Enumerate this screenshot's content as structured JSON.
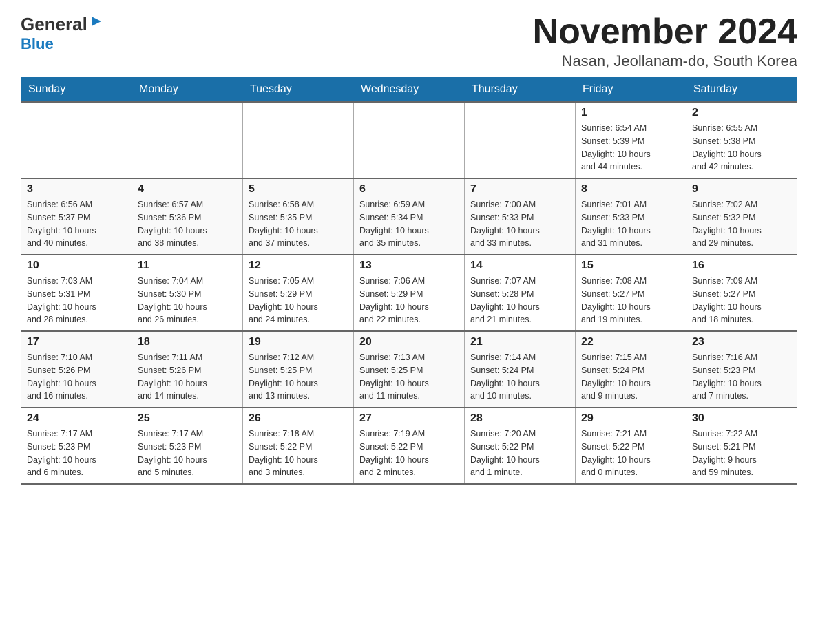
{
  "header": {
    "logo_general": "General",
    "logo_blue": "Blue",
    "month_title": "November 2024",
    "location": "Nasan, Jeollanam-do, South Korea"
  },
  "weekdays": [
    "Sunday",
    "Monday",
    "Tuesday",
    "Wednesday",
    "Thursday",
    "Friday",
    "Saturday"
  ],
  "weeks": [
    [
      {
        "day": "",
        "info": ""
      },
      {
        "day": "",
        "info": ""
      },
      {
        "day": "",
        "info": ""
      },
      {
        "day": "",
        "info": ""
      },
      {
        "day": "",
        "info": ""
      },
      {
        "day": "1",
        "info": "Sunrise: 6:54 AM\nSunset: 5:39 PM\nDaylight: 10 hours\nand 44 minutes."
      },
      {
        "day": "2",
        "info": "Sunrise: 6:55 AM\nSunset: 5:38 PM\nDaylight: 10 hours\nand 42 minutes."
      }
    ],
    [
      {
        "day": "3",
        "info": "Sunrise: 6:56 AM\nSunset: 5:37 PM\nDaylight: 10 hours\nand 40 minutes."
      },
      {
        "day": "4",
        "info": "Sunrise: 6:57 AM\nSunset: 5:36 PM\nDaylight: 10 hours\nand 38 minutes."
      },
      {
        "day": "5",
        "info": "Sunrise: 6:58 AM\nSunset: 5:35 PM\nDaylight: 10 hours\nand 37 minutes."
      },
      {
        "day": "6",
        "info": "Sunrise: 6:59 AM\nSunset: 5:34 PM\nDaylight: 10 hours\nand 35 minutes."
      },
      {
        "day": "7",
        "info": "Sunrise: 7:00 AM\nSunset: 5:33 PM\nDaylight: 10 hours\nand 33 minutes."
      },
      {
        "day": "8",
        "info": "Sunrise: 7:01 AM\nSunset: 5:33 PM\nDaylight: 10 hours\nand 31 minutes."
      },
      {
        "day": "9",
        "info": "Sunrise: 7:02 AM\nSunset: 5:32 PM\nDaylight: 10 hours\nand 29 minutes."
      }
    ],
    [
      {
        "day": "10",
        "info": "Sunrise: 7:03 AM\nSunset: 5:31 PM\nDaylight: 10 hours\nand 28 minutes."
      },
      {
        "day": "11",
        "info": "Sunrise: 7:04 AM\nSunset: 5:30 PM\nDaylight: 10 hours\nand 26 minutes."
      },
      {
        "day": "12",
        "info": "Sunrise: 7:05 AM\nSunset: 5:29 PM\nDaylight: 10 hours\nand 24 minutes."
      },
      {
        "day": "13",
        "info": "Sunrise: 7:06 AM\nSunset: 5:29 PM\nDaylight: 10 hours\nand 22 minutes."
      },
      {
        "day": "14",
        "info": "Sunrise: 7:07 AM\nSunset: 5:28 PM\nDaylight: 10 hours\nand 21 minutes."
      },
      {
        "day": "15",
        "info": "Sunrise: 7:08 AM\nSunset: 5:27 PM\nDaylight: 10 hours\nand 19 minutes."
      },
      {
        "day": "16",
        "info": "Sunrise: 7:09 AM\nSunset: 5:27 PM\nDaylight: 10 hours\nand 18 minutes."
      }
    ],
    [
      {
        "day": "17",
        "info": "Sunrise: 7:10 AM\nSunset: 5:26 PM\nDaylight: 10 hours\nand 16 minutes."
      },
      {
        "day": "18",
        "info": "Sunrise: 7:11 AM\nSunset: 5:26 PM\nDaylight: 10 hours\nand 14 minutes."
      },
      {
        "day": "19",
        "info": "Sunrise: 7:12 AM\nSunset: 5:25 PM\nDaylight: 10 hours\nand 13 minutes."
      },
      {
        "day": "20",
        "info": "Sunrise: 7:13 AM\nSunset: 5:25 PM\nDaylight: 10 hours\nand 11 minutes."
      },
      {
        "day": "21",
        "info": "Sunrise: 7:14 AM\nSunset: 5:24 PM\nDaylight: 10 hours\nand 10 minutes."
      },
      {
        "day": "22",
        "info": "Sunrise: 7:15 AM\nSunset: 5:24 PM\nDaylight: 10 hours\nand 9 minutes."
      },
      {
        "day": "23",
        "info": "Sunrise: 7:16 AM\nSunset: 5:23 PM\nDaylight: 10 hours\nand 7 minutes."
      }
    ],
    [
      {
        "day": "24",
        "info": "Sunrise: 7:17 AM\nSunset: 5:23 PM\nDaylight: 10 hours\nand 6 minutes."
      },
      {
        "day": "25",
        "info": "Sunrise: 7:17 AM\nSunset: 5:23 PM\nDaylight: 10 hours\nand 5 minutes."
      },
      {
        "day": "26",
        "info": "Sunrise: 7:18 AM\nSunset: 5:22 PM\nDaylight: 10 hours\nand 3 minutes."
      },
      {
        "day": "27",
        "info": "Sunrise: 7:19 AM\nSunset: 5:22 PM\nDaylight: 10 hours\nand 2 minutes."
      },
      {
        "day": "28",
        "info": "Sunrise: 7:20 AM\nSunset: 5:22 PM\nDaylight: 10 hours\nand 1 minute."
      },
      {
        "day": "29",
        "info": "Sunrise: 7:21 AM\nSunset: 5:22 PM\nDaylight: 10 hours\nand 0 minutes."
      },
      {
        "day": "30",
        "info": "Sunrise: 7:22 AM\nSunset: 5:21 PM\nDaylight: 9 hours\nand 59 minutes."
      }
    ]
  ]
}
